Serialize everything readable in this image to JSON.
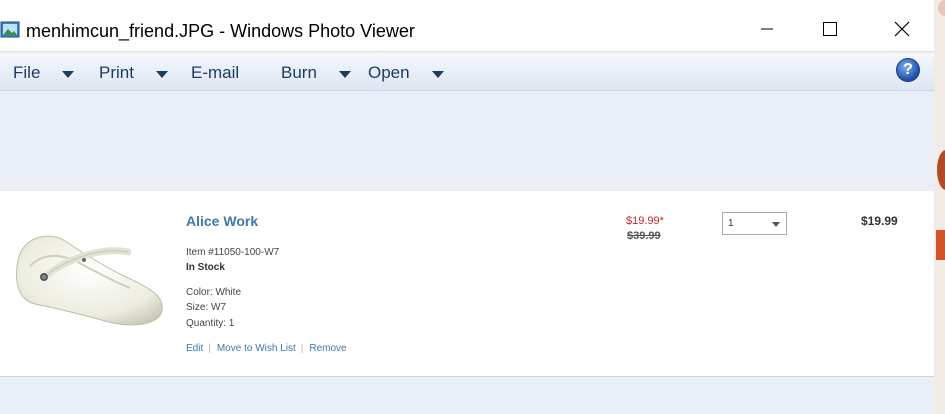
{
  "window": {
    "title": "menhimcun_friend.JPG - Windows Photo Viewer",
    "icon": "photo-viewer-icon"
  },
  "menu": {
    "items": [
      {
        "label": "File",
        "has_dropdown": true
      },
      {
        "label": "Print",
        "has_dropdown": true
      },
      {
        "label": "E-mail",
        "has_dropdown": false
      },
      {
        "label": "Burn",
        "has_dropdown": true
      },
      {
        "label": "Open",
        "has_dropdown": true
      }
    ],
    "help_label": "?"
  },
  "product": {
    "title": "Alice Work",
    "item_number": "Item #11050-100-W7",
    "stock": "In Stock",
    "color": "Color:  White",
    "size": "Size:  W7",
    "quantity": "Quantity:  1",
    "links": {
      "edit": "Edit",
      "wishlist": "Move to Wish List",
      "remove": "Remove"
    },
    "sale_price": "$19.99*",
    "original_price": "$39.99",
    "qty_value": "1",
    "total": "$19.99"
  },
  "colors": {
    "link": "#3d79ad",
    "sale": "#c0272d",
    "chrome": "#e9eef7"
  }
}
